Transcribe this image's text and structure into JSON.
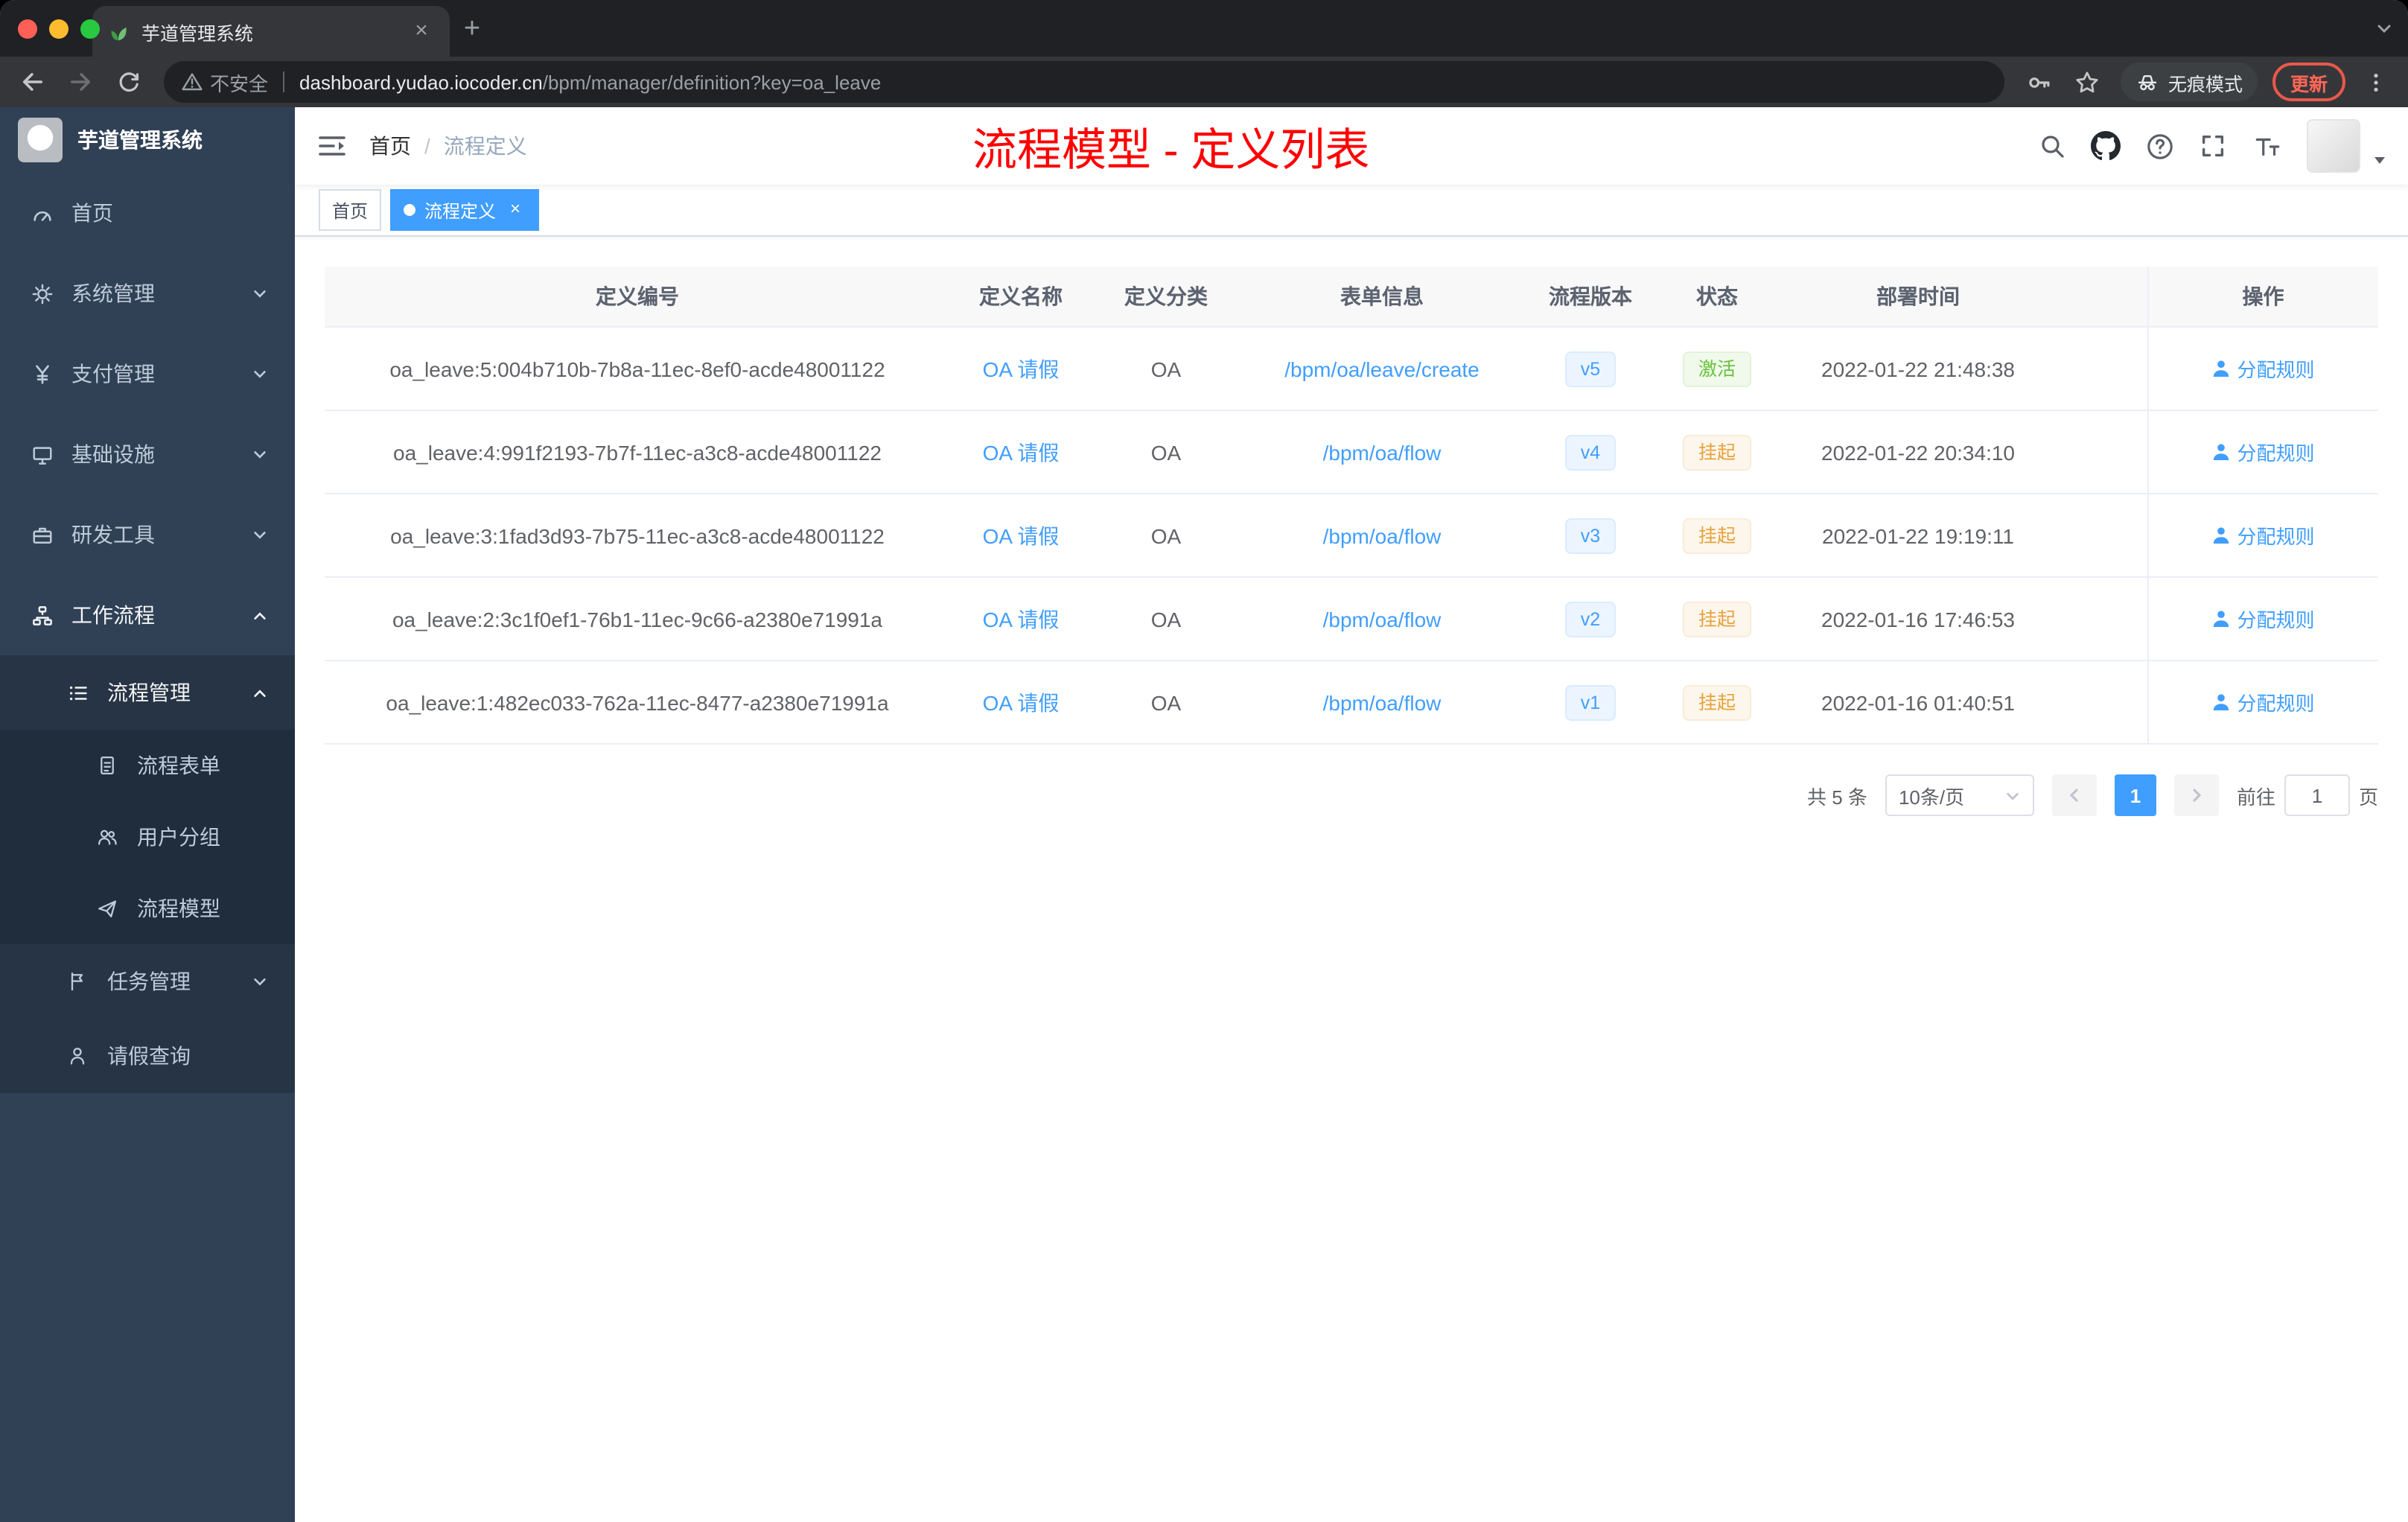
{
  "browser": {
    "tab_title": "芋道管理系统",
    "security_label": "不安全",
    "url_host": "dashboard.yudao.iocoder.cn",
    "url_path": "/bpm/manager/definition?key=oa_leave",
    "incognito_label": "无痕模式",
    "update_label": "更新"
  },
  "icons": {
    "close": "×",
    "plus": "+"
  },
  "colors": {
    "accent": "#409eff",
    "success": "#67c23a",
    "warning": "#e6a23c",
    "title_red": "#ff0000",
    "sidebar_bg": "#304156",
    "sidebar_submenu_bg": "#263445",
    "sidebar_submenu_deep_bg": "#1f2d3d"
  },
  "sidebar": {
    "logo_title": "芋道管理系统",
    "items": [
      {
        "label": "首页",
        "icon": "dashboard-icon",
        "level": 1
      },
      {
        "label": "系统管理",
        "icon": "gear-icon",
        "level": 1,
        "arrow": "down"
      },
      {
        "label": "支付管理",
        "icon": "yen-icon",
        "level": 1,
        "arrow": "down"
      },
      {
        "label": "基础设施",
        "icon": "monitor-icon",
        "level": 1,
        "arrow": "down"
      },
      {
        "label": "研发工具",
        "icon": "briefcase-icon",
        "level": 1,
        "arrow": "down"
      },
      {
        "label": "工作流程",
        "icon": "sitemap-icon",
        "level": 1,
        "arrow": "up"
      },
      {
        "label": "流程管理",
        "icon": "list-icon",
        "level": 2,
        "arrow": "up"
      },
      {
        "label": "流程表单",
        "icon": "form-icon",
        "level": 3
      },
      {
        "label": "用户分组",
        "icon": "users-icon",
        "level": 3
      },
      {
        "label": "流程模型",
        "icon": "plane-icon",
        "level": 3
      },
      {
        "label": "任务管理",
        "icon": "flag-icon",
        "level": 2,
        "arrow": "down"
      },
      {
        "label": "请假查询",
        "icon": "person-icon",
        "level": 2
      }
    ]
  },
  "navbar": {
    "breadcrumb_home": "首页",
    "breadcrumb_sep": "/",
    "breadcrumb_current": "流程定义",
    "page_title": "流程模型 - 定义列表"
  },
  "tags": {
    "home": "首页",
    "current": "流程定义"
  },
  "table": {
    "columns": [
      "定义编号",
      "定义名称",
      "定义分类",
      "表单信息",
      "流程版本",
      "状态",
      "部署时间",
      "操作"
    ],
    "rows": [
      {
        "id": "oa_leave:5:004b710b-7b8a-11ec-8ef0-acde48001122",
        "name": "OA 请假",
        "category": "OA",
        "form": "/bpm/oa/leave/create",
        "version": "v5",
        "status": "激活",
        "time": "2022-01-22 21:48:38",
        "action": "分配规则"
      },
      {
        "id": "oa_leave:4:991f2193-7b7f-11ec-a3c8-acde48001122",
        "name": "OA 请假",
        "category": "OA",
        "form": "/bpm/oa/flow",
        "version": "v4",
        "status": "挂起",
        "time": "2022-01-22 20:34:10",
        "action": "分配规则"
      },
      {
        "id": "oa_leave:3:1fad3d93-7b75-11ec-a3c8-acde48001122",
        "name": "OA 请假",
        "category": "OA",
        "form": "/bpm/oa/flow",
        "version": "v3",
        "status": "挂起",
        "time": "2022-01-22 19:19:11",
        "action": "分配规则"
      },
      {
        "id": "oa_leave:2:3c1f0ef1-76b1-11ec-9c66-a2380e71991a",
        "name": "OA 请假",
        "category": "OA",
        "form": "/bpm/oa/flow",
        "version": "v2",
        "status": "挂起",
        "time": "2022-01-16 17:46:53",
        "action": "分配规则"
      },
      {
        "id": "oa_leave:1:482ec033-762a-11ec-8477-a2380e71991a",
        "name": "OA 请假",
        "category": "OA",
        "form": "/bpm/oa/flow",
        "version": "v1",
        "status": "挂起",
        "time": "2022-01-16 01:40:51",
        "action": "分配规则"
      }
    ]
  },
  "pagination": {
    "total": "共 5 条",
    "size": "10条/页",
    "current": "1",
    "goto_label": "前往",
    "goto_value": "1",
    "unit": "页"
  }
}
